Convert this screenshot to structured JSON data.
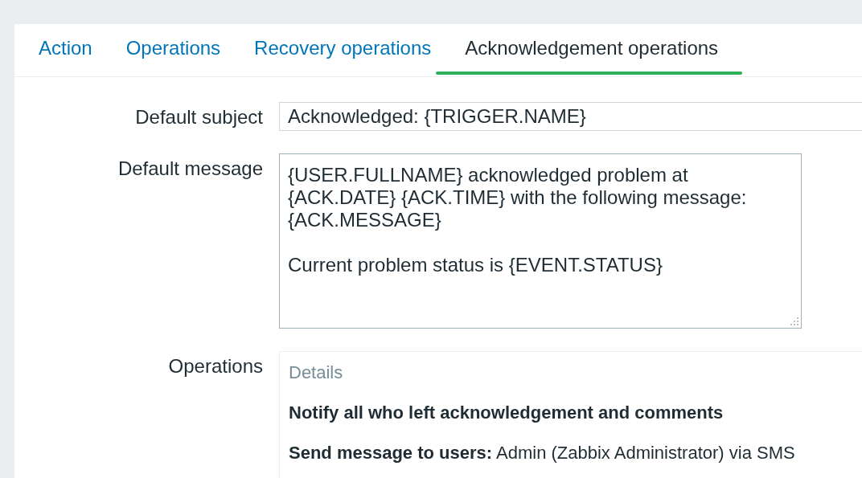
{
  "tabs": [
    {
      "label": "Action",
      "selected": false
    },
    {
      "label": "Operations",
      "selected": false
    },
    {
      "label": "Recovery operations",
      "selected": false
    },
    {
      "label": "Acknowledgement operations",
      "selected": true
    }
  ],
  "form": {
    "default_subject": {
      "label": "Default subject",
      "value": "Acknowledged: {TRIGGER.NAME}"
    },
    "default_message": {
      "label": "Default message",
      "value": "{USER.FULLNAME} acknowledged problem at\n{ACK.DATE} {ACK.TIME} with the following message:\n{ACK.MESSAGE}\n\nCurrent problem status is {EVENT.STATUS}"
    },
    "operations": {
      "label": "Operations",
      "heading": "Details",
      "items": [
        "**Notify all who left acknowledgement and comments**",
        "**Send message to users:** Admin (Zabbix Administrator) via SMS"
      ]
    }
  }
}
